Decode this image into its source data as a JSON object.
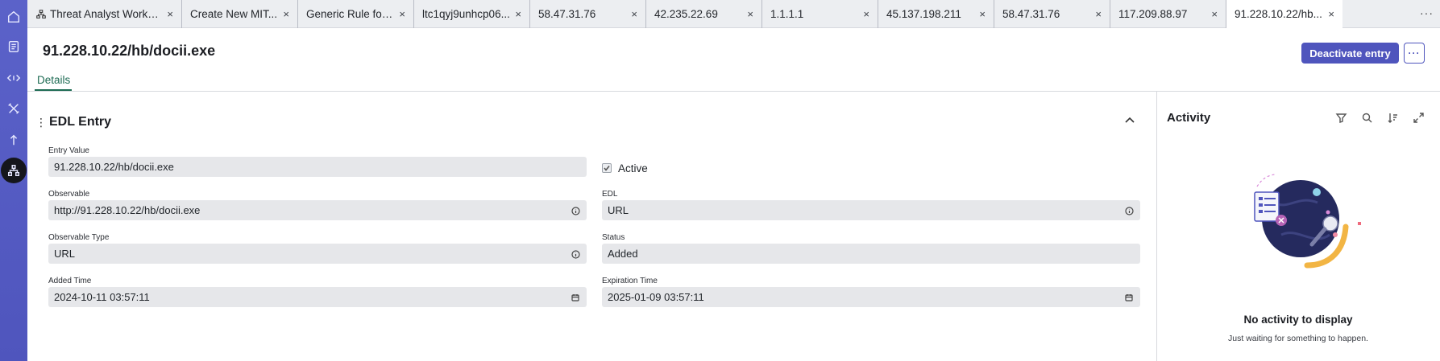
{
  "tabs": [
    {
      "label": "Threat Analyst Workbe...",
      "icon": "workflow-icon",
      "active": false
    },
    {
      "label": "Create New MIT...",
      "active": false
    },
    {
      "label": "Generic Rule for ...",
      "active": false
    },
    {
      "label": "ltc1qyj9unhcp06...",
      "active": false
    },
    {
      "label": "58.47.31.76",
      "active": false
    },
    {
      "label": "42.235.22.69",
      "active": false
    },
    {
      "label": "1.1.1.1",
      "active": false
    },
    {
      "label": "45.137.198.211",
      "active": false
    },
    {
      "label": "58.47.31.76",
      "active": false
    },
    {
      "label": "117.209.88.97",
      "active": false
    },
    {
      "label": "91.228.10.22/hb...",
      "active": true
    }
  ],
  "tab_close": "×",
  "tab_more": "···",
  "header": {
    "title": "91.228.10.22/hb/docii.exe",
    "deactivate_label": "Deactivate entry",
    "more_label": "···"
  },
  "nav": {
    "details_tab": "Details"
  },
  "edl": {
    "section_title": "EDL Entry",
    "entry_value_label": "Entry Value",
    "entry_value": "91.228.10.22/hb/docii.exe",
    "active_label": "Active",
    "active_checked": true,
    "observable_label": "Observable",
    "observable_value": "http://91.228.10.22/hb/docii.exe",
    "edl_label": "EDL",
    "edl_value": "URL",
    "observable_type_label": "Observable Type",
    "observable_type_value": "URL",
    "status_label": "Status",
    "status_value": "Added",
    "added_time_label": "Added Time",
    "added_time_value": "2024-10-11 03:57:11",
    "expiration_time_label": "Expiration Time",
    "expiration_time_value": "2025-01-09 03:57:11"
  },
  "activity": {
    "title": "Activity",
    "empty_title": "No activity to display",
    "empty_subtitle": "Just waiting for something to happen.",
    "tools": [
      "filter-icon",
      "search-icon",
      "sort-icon",
      "expand-icon"
    ]
  },
  "rail_icons": [
    "home-icon",
    "notebook-icon",
    "code-icon",
    "tools-icon",
    "upload-icon",
    "network-icon"
  ],
  "colors": {
    "accent": "#4f55bd",
    "rail": "#5b62c9",
    "details_tab": "#1d6b53",
    "field_bg": "#e6e7ea"
  }
}
